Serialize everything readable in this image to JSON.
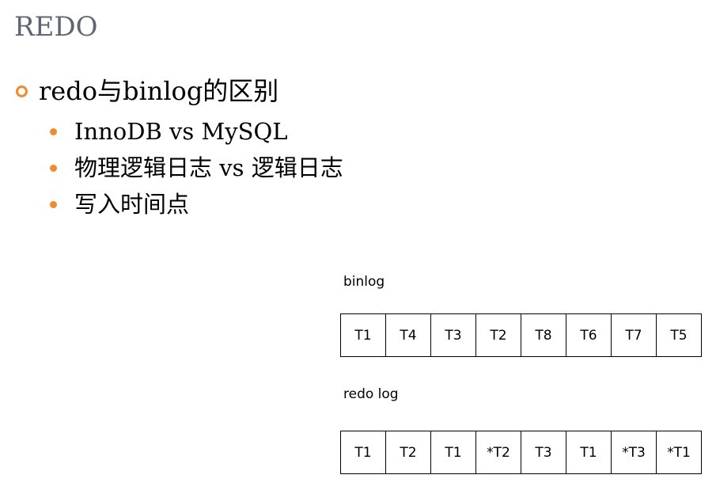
{
  "title": "REDO",
  "main_bullet": "redo与binlog的区别",
  "sub_bullets": [
    "InnoDB vs MySQL",
    "物理逻辑日志 vs 逻辑日志",
    "写入时间点"
  ],
  "diagram": {
    "binlog": {
      "label": "binlog",
      "cells": [
        "T1",
        "T4",
        "T3",
        "T2",
        "T8",
        "T6",
        "T7",
        "T5"
      ]
    },
    "redo_log": {
      "label": "redo log",
      "cells": [
        "T1",
        "T2",
        "T1",
        "*T2",
        "T3",
        "T1",
        "*T3",
        "*T1"
      ]
    }
  },
  "colors": {
    "title": "#5e6574",
    "bullet_accent": "#f08a2a"
  }
}
